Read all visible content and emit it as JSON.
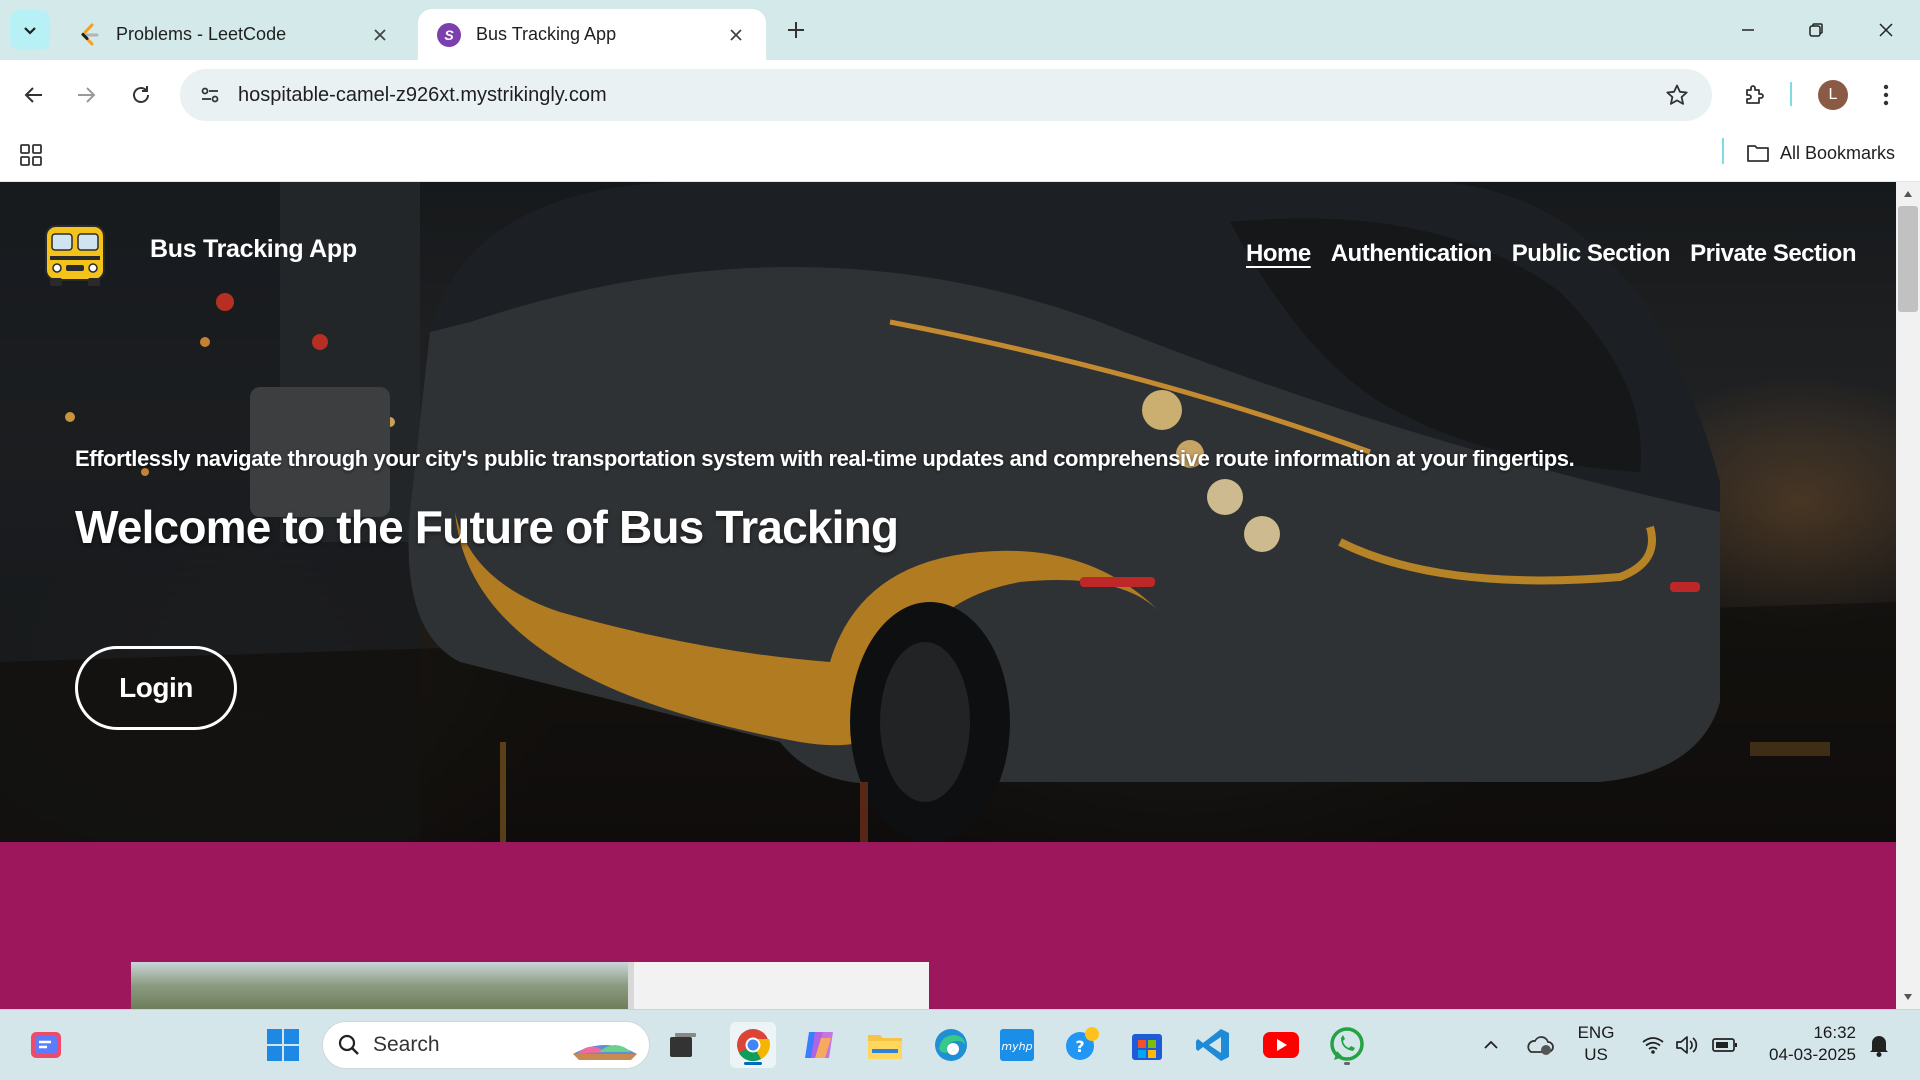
{
  "browser": {
    "tabs": [
      {
        "title": "Problems - LeetCode",
        "active": false
      },
      {
        "title": "Bus Tracking App",
        "active": true
      }
    ],
    "url": "hospitable-camel-z926xt.mystrikingly.com",
    "profile_initial": "L",
    "bookmarks_label": "All Bookmarks"
  },
  "site": {
    "brand": "Bus Tracking App",
    "nav": [
      "Home",
      "Authentication",
      "Public Section",
      "Private Section"
    ],
    "current_nav": "Home",
    "tagline": "Effortlessly navigate through your city's public transportation system with real-time updates and comprehensive route information at your fingertips.",
    "headline": "Welcome to the Future of Bus Tracking",
    "login_button": "Login",
    "section2_color": "#9d175d"
  },
  "taskbar": {
    "search_placeholder": "Search",
    "language": "ENG",
    "region": "US",
    "time": "16:32",
    "date": "04-03-2025",
    "apps": [
      "start",
      "search",
      "widgets",
      "chrome",
      "copilot",
      "file-explorer",
      "edge",
      "myhp",
      "help",
      "store",
      "vscode",
      "youtube",
      "whatsapp"
    ]
  }
}
